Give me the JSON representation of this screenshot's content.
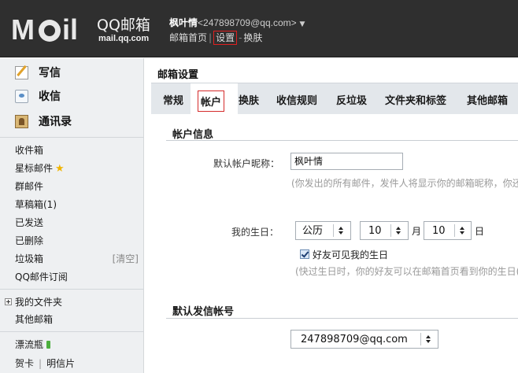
{
  "header": {
    "logo_cn": "QQ邮箱",
    "logo_domain": "mail.qq.com",
    "user_nickname": "枫叶情",
    "user_email": "<247898709@qq.com>",
    "links": [
      "邮箱首页",
      "设置",
      "换肤"
    ]
  },
  "sidebar": {
    "primary": [
      "写信",
      "收信",
      "通讯录"
    ],
    "folders": [
      "收件箱",
      "星标邮件",
      "群邮件",
      "草稿箱(1)",
      "已发送",
      "已删除",
      "垃圾箱",
      "QQ邮件订阅"
    ],
    "trash_clear": "[清空]",
    "my_folders": "我的文件夹",
    "other_mailboxes": "其他邮箱",
    "drift_bottle": "漂流瓶",
    "greeting_card": "贺卡",
    "postcard": "明信片"
  },
  "main": {
    "title": "邮箱设置",
    "tabs": [
      "常规",
      "帐户",
      "换肤",
      "收信规则",
      "反垃圾",
      "文件夹和标签",
      "其他邮箱"
    ],
    "active_tab": "帐户",
    "account_section": "帐户信息",
    "nickname_label": "默认帐户昵称：",
    "nickname_value": "枫叶情",
    "nickname_hint": "(你发出的所有邮件，发件人将显示你的邮箱昵称，你还",
    "birthday_label": "我的生日：",
    "calendar_value": "公历",
    "month_value": "10",
    "month_unit": "月",
    "day_value": "10",
    "day_unit": "日",
    "birthday_checkbox_label": "好友可见我的生日",
    "birthday_checkbox_checked": true,
    "birthday_hint": "(快过生日时，你的好友可以在邮箱首页看到你的生日(",
    "sender_section": "默认发信帐号",
    "sender_value": "247898709@qq.com"
  },
  "colors": {
    "header_bg": "#2f2f2f",
    "sidebar_bg": "#eef0f2",
    "tabbar_bg": "#e3e7eb",
    "highlight_border": "#e02020",
    "star": "#f0b400"
  },
  "icons": [
    "write-icon",
    "inbox-icon",
    "contacts-icon",
    "star-icon",
    "expand-icon",
    "bottle-icon",
    "dropdown-arrow-icon",
    "checkbox-icon"
  ]
}
